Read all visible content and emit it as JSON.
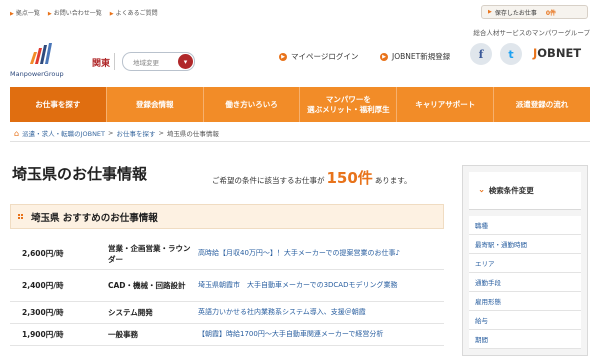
{
  "utility_links": [
    "拠点一覧",
    "お問い合わせ一覧",
    "よくあるご質問"
  ],
  "saved_jobs": {
    "label": "保存したお仕事",
    "count": "0件"
  },
  "tagline": "総合人材サービスのマンパワーグループ",
  "logo_text": "ManpowerGroup",
  "region": {
    "current": "関東",
    "change_placeholder": "地域変更"
  },
  "header_links": {
    "mypage": "マイページログイン",
    "jobnet_register": "JOBNET新規登録"
  },
  "social": {
    "facebook": "f",
    "twitter": "t"
  },
  "jobnet_logo": {
    "prefix": "J",
    "rest": "OBNET"
  },
  "nav": [
    {
      "label": "お仕事を探す",
      "active": true
    },
    {
      "label": "登録会情報"
    },
    {
      "label": "働き方いろいろ"
    },
    {
      "label": "マンパワーを\n選ぶメリット・福利厚生"
    },
    {
      "label": "キャリアサポート"
    },
    {
      "label": "派遣登録の流れ"
    }
  ],
  "breadcrumb": [
    {
      "label": "派遣・求人・転職のJOBNET",
      "link": true
    },
    {
      "label": "お仕事を探す",
      "link": true
    },
    {
      "label": "埼玉県の仕事情報",
      "link": false
    }
  ],
  "page_title": "埼玉県のお仕事情報",
  "summary": {
    "pre": "ご希望の条件に該当するお仕事が",
    "count": "150件",
    "post": "あります。"
  },
  "section_title": "埼玉県 おすすめのお仕事情報",
  "jobs": [
    {
      "salary": "2,600円/時",
      "category": "営業・企画営業・ラウンダー",
      "title": "高時給【月収40万円〜】！大手メーカーでの提案営業のお仕事♪"
    },
    {
      "salary": "2,400円/時",
      "category": "CAD・機械・回路設計",
      "title": "埼玉県朝霞市　大手自動車メーカーでの3DCADモデリング業務"
    },
    {
      "salary": "2,300円/時",
      "category": "システム開発",
      "title": "英語力いかせる社内業務系システム導入、支援＠朝霞"
    },
    {
      "salary": "1,900円/時",
      "category": "一般事務",
      "title": "【朝霞】時給1700円〜大手自動車関連メーカーで経営分析"
    }
  ],
  "sidebar": {
    "title": "検索条件変更",
    "items": [
      "職種",
      "最寄駅・通勤時間",
      "エリア",
      "通勤手段",
      "雇用形態",
      "給与",
      "期間"
    ]
  }
}
